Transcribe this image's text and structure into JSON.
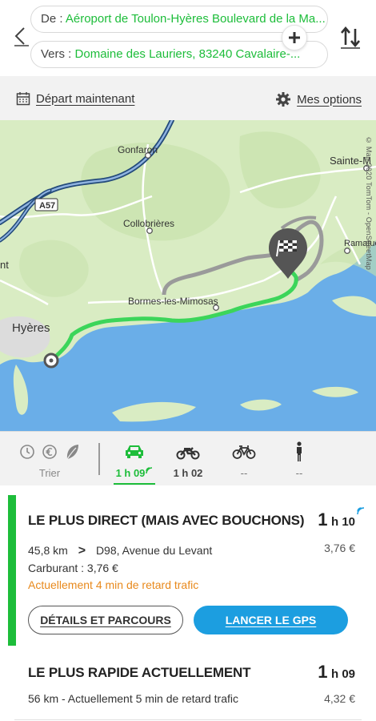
{
  "header": {
    "from_label": "De :",
    "from_value": "Aéroport de Toulon-Hyères Boulevard de la Ma...",
    "to_label": "Vers :",
    "to_value": "Domaine des Lauriers, 83240 Cavalaire-..."
  },
  "options_bar": {
    "depart_label": "Départ maintenant",
    "options_label": "Mes options"
  },
  "map": {
    "labels": [
      "Gonfaron",
      "A57",
      "Collobrières",
      "Sainte-M",
      "Ramatuelle",
      "Bormes-les-Mimosas",
      "Hyères",
      "nt"
    ],
    "copyright": "© Map 2020 TomTom - OpenStreetMap"
  },
  "modes": {
    "sort_label": "Trier",
    "car_time": "1 h 09",
    "moto_time": "1 h 02",
    "bike_time": "--",
    "walk_time": "--"
  },
  "routes": [
    {
      "title": "LE PLUS DIRECT (MAIS AVEC BOUCHONS)",
      "time_h": "1",
      "time_m": "h 10",
      "price": "3,76 €",
      "distance": "45,8 km",
      "via": "D98, Avenue du Levant",
      "fuel": "Carburant : 3,76 €",
      "traffic": "Actuellement 4 min de retard trafic",
      "details_btn": "DÉTAILS ET PARCOURS",
      "gps_btn": "LANCER LE GPS"
    },
    {
      "title": "LE PLUS RAPIDE ACTUELLEMENT",
      "time_h": "1",
      "time_m": "h 09",
      "price": "4,32 €",
      "summary": "56 km - Actuellement 5 min de retard trafic"
    }
  ],
  "colors": {
    "accent_green": "#1dbd3a",
    "gps_blue": "#1c9ee0",
    "traffic_orange": "#e8891c",
    "sea": "#6aaee8",
    "land": "#d9ecc3"
  }
}
